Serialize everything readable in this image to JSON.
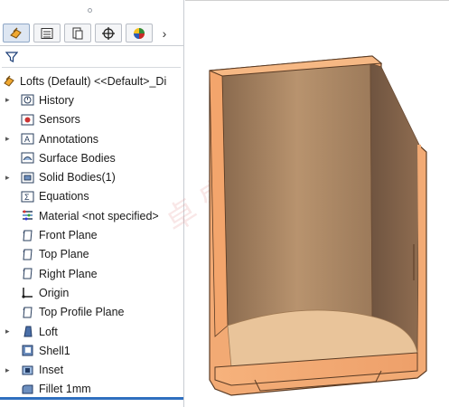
{
  "tree": {
    "root_label": "Lofts (Default) <<Default>_Di",
    "items": [
      {
        "label": "History",
        "icon": "history-folder-icon",
        "expand": true
      },
      {
        "label": "Sensors",
        "icon": "sensors-folder-icon",
        "expand": false
      },
      {
        "label": "Annotations",
        "icon": "annotations-folder-icon",
        "expand": true
      },
      {
        "label": "Surface Bodies",
        "icon": "surface-bodies-folder-icon",
        "expand": false
      },
      {
        "label": "Solid Bodies(1)",
        "icon": "solid-bodies-folder-icon",
        "expand": true
      },
      {
        "label": "Equations",
        "icon": "equations-folder-icon",
        "expand": false
      },
      {
        "label": "Material <not specified>",
        "icon": "material-icon",
        "expand": false
      },
      {
        "label": "Front Plane",
        "icon": "plane-icon",
        "expand": false
      },
      {
        "label": "Top Plane",
        "icon": "plane-icon",
        "expand": false
      },
      {
        "label": "Right Plane",
        "icon": "plane-icon",
        "expand": false
      },
      {
        "label": "Origin",
        "icon": "origin-icon",
        "expand": false
      },
      {
        "label": "Top Profile Plane",
        "icon": "plane-icon",
        "expand": false
      },
      {
        "label": "Loft",
        "icon": "loft-feature-icon",
        "expand": true
      },
      {
        "label": "Shell1",
        "icon": "shell-feature-icon",
        "expand": false
      },
      {
        "label": "Inset",
        "icon": "inset-feature-icon",
        "expand": true
      },
      {
        "label": "Fillet 1mm",
        "icon": "fillet-feature-icon",
        "expand": false
      }
    ]
  },
  "tabs": [
    "feature-manager-tab",
    "property-manager-tab",
    "configuration-manager-tab",
    "dimxpert-manager-tab",
    "display-manager-tab"
  ],
  "colors": {
    "accent": "#2f6fbf",
    "part_face": "#f2aa74",
    "part_inner": "#b48a64",
    "part_edge": "#5a3b24"
  }
}
